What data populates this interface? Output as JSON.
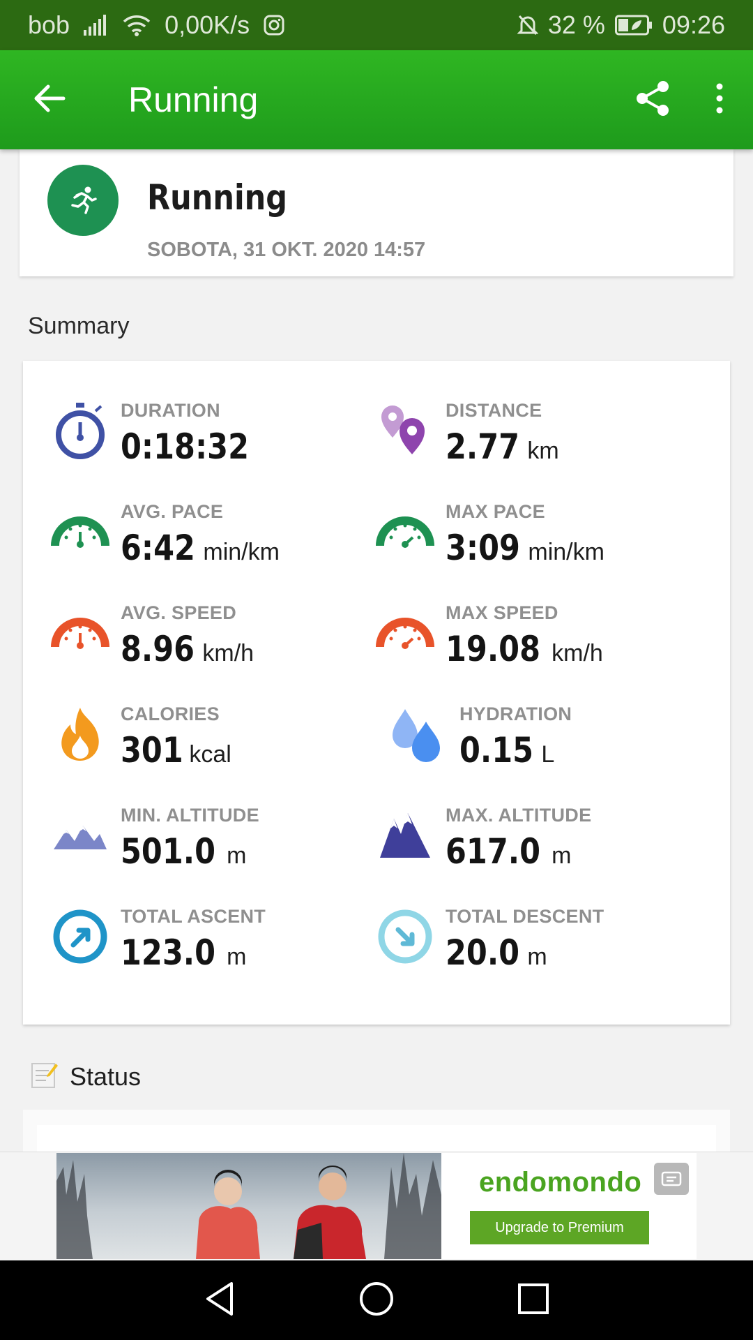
{
  "status_bar": {
    "carrier": "bob",
    "net_speed": "0,00K/s",
    "battery_percent": "32 %",
    "time": "09:26",
    "icons": [
      "signal-icon",
      "wifi-icon",
      "instagram-icon",
      "bell-off-icon",
      "battery-icon"
    ]
  },
  "app_bar": {
    "title": "Running",
    "icons": [
      "back-arrow-icon",
      "share-icon",
      "more-vert-icon"
    ]
  },
  "workout": {
    "name": "Running",
    "datetime": "SOBOTA, 31 OKT. 2020 14:57",
    "icon": "running-person-icon",
    "icon_color": "#1e9152"
  },
  "summary": {
    "section_label": "Summary",
    "stats": [
      {
        "label": "DURATION",
        "value": "0:18:32",
        "unit": "",
        "icon": "stopwatch-icon"
      },
      {
        "label": "DISTANCE",
        "value": "2.77",
        "unit": "km",
        "icon": "map-pins-icon"
      },
      {
        "label": "AVG. PACE",
        "value": "6:42",
        "unit": "min/km",
        "icon": "gauge-icon"
      },
      {
        "label": "MAX PACE",
        "value": "3:09",
        "unit": "min/km",
        "icon": "gauge-icon"
      },
      {
        "label": "AVG. SPEED",
        "value": "8.96",
        "unit": "km/h",
        "icon": "speedometer-icon"
      },
      {
        "label": "MAX SPEED",
        "value": "19.08",
        "unit": "km/h",
        "icon": "speedometer-icon"
      },
      {
        "label": "CALORIES",
        "value": "301",
        "unit": "kcal",
        "icon": "flame-icon"
      },
      {
        "label": "HYDRATION",
        "value": "0.15",
        "unit": "L",
        "icon": "water-drops-icon"
      },
      {
        "label": "MIN. ALTITUDE",
        "value": "501.0",
        "unit": "m",
        "icon": "mountains-icon"
      },
      {
        "label": "MAX. ALTITUDE",
        "value": "617.0",
        "unit": "m",
        "icon": "mountains-icon"
      },
      {
        "label": "TOTAL ASCENT",
        "value": "123.0",
        "unit": "m",
        "icon": "ascent-arrow-icon"
      },
      {
        "label": "TOTAL DESCENT",
        "value": "20.0",
        "unit": "m",
        "icon": "descent-arrow-icon"
      }
    ],
    "colors": {
      "duration": "#3f51a5",
      "distance": "#8e44ad",
      "pace": "#1e9152",
      "speed": "#e8532a",
      "calories": "#f39a1e",
      "hydration": "#4a8ff0",
      "altitude_min": "#7b86c8",
      "altitude_max": "#3f3f9a",
      "ascent": "#1f94c8",
      "descent": "#8fd6e6"
    }
  },
  "status_section": {
    "label": "Status",
    "icon": "note-edit-icon"
  },
  "ad": {
    "brand": "endomondo",
    "cta": "Upgrade to Premium",
    "icon": "ad-badge-icon"
  },
  "nav_bar": {
    "icons": [
      "nav-back-icon",
      "nav-home-icon",
      "nav-recents-icon"
    ]
  }
}
